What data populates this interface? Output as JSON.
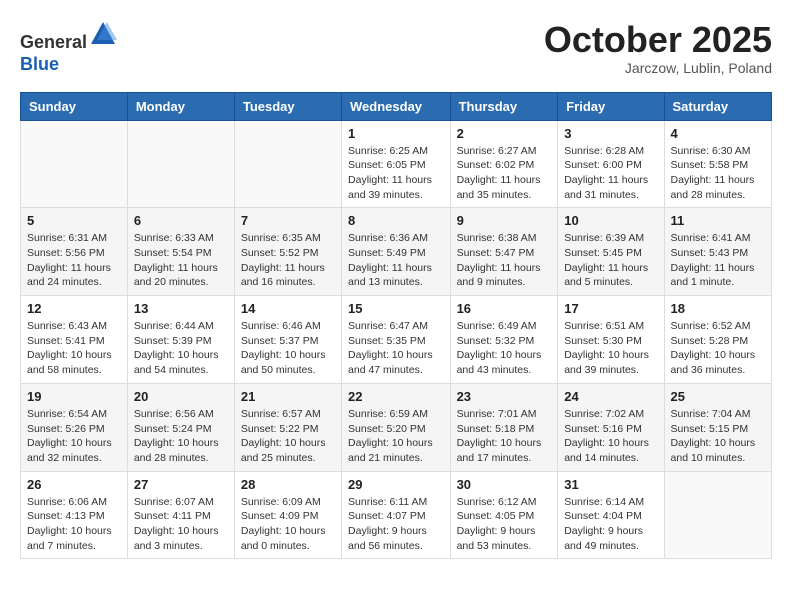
{
  "header": {
    "logo_line1": "General",
    "logo_line2": "Blue",
    "month": "October 2025",
    "location": "Jarczow, Lublin, Poland"
  },
  "weekdays": [
    "Sunday",
    "Monday",
    "Tuesday",
    "Wednesday",
    "Thursday",
    "Friday",
    "Saturday"
  ],
  "weeks": [
    [
      {
        "day": "",
        "info": ""
      },
      {
        "day": "",
        "info": ""
      },
      {
        "day": "",
        "info": ""
      },
      {
        "day": "1",
        "info": "Sunrise: 6:25 AM\nSunset: 6:05 PM\nDaylight: 11 hours\nand 39 minutes."
      },
      {
        "day": "2",
        "info": "Sunrise: 6:27 AM\nSunset: 6:02 PM\nDaylight: 11 hours\nand 35 minutes."
      },
      {
        "day": "3",
        "info": "Sunrise: 6:28 AM\nSunset: 6:00 PM\nDaylight: 11 hours\nand 31 minutes."
      },
      {
        "day": "4",
        "info": "Sunrise: 6:30 AM\nSunset: 5:58 PM\nDaylight: 11 hours\nand 28 minutes."
      }
    ],
    [
      {
        "day": "5",
        "info": "Sunrise: 6:31 AM\nSunset: 5:56 PM\nDaylight: 11 hours\nand 24 minutes."
      },
      {
        "day": "6",
        "info": "Sunrise: 6:33 AM\nSunset: 5:54 PM\nDaylight: 11 hours\nand 20 minutes."
      },
      {
        "day": "7",
        "info": "Sunrise: 6:35 AM\nSunset: 5:52 PM\nDaylight: 11 hours\nand 16 minutes."
      },
      {
        "day": "8",
        "info": "Sunrise: 6:36 AM\nSunset: 5:49 PM\nDaylight: 11 hours\nand 13 minutes."
      },
      {
        "day": "9",
        "info": "Sunrise: 6:38 AM\nSunset: 5:47 PM\nDaylight: 11 hours\nand 9 minutes."
      },
      {
        "day": "10",
        "info": "Sunrise: 6:39 AM\nSunset: 5:45 PM\nDaylight: 11 hours\nand 5 minutes."
      },
      {
        "day": "11",
        "info": "Sunrise: 6:41 AM\nSunset: 5:43 PM\nDaylight: 11 hours\nand 1 minute."
      }
    ],
    [
      {
        "day": "12",
        "info": "Sunrise: 6:43 AM\nSunset: 5:41 PM\nDaylight: 10 hours\nand 58 minutes."
      },
      {
        "day": "13",
        "info": "Sunrise: 6:44 AM\nSunset: 5:39 PM\nDaylight: 10 hours\nand 54 minutes."
      },
      {
        "day": "14",
        "info": "Sunrise: 6:46 AM\nSunset: 5:37 PM\nDaylight: 10 hours\nand 50 minutes."
      },
      {
        "day": "15",
        "info": "Sunrise: 6:47 AM\nSunset: 5:35 PM\nDaylight: 10 hours\nand 47 minutes."
      },
      {
        "day": "16",
        "info": "Sunrise: 6:49 AM\nSunset: 5:32 PM\nDaylight: 10 hours\nand 43 minutes."
      },
      {
        "day": "17",
        "info": "Sunrise: 6:51 AM\nSunset: 5:30 PM\nDaylight: 10 hours\nand 39 minutes."
      },
      {
        "day": "18",
        "info": "Sunrise: 6:52 AM\nSunset: 5:28 PM\nDaylight: 10 hours\nand 36 minutes."
      }
    ],
    [
      {
        "day": "19",
        "info": "Sunrise: 6:54 AM\nSunset: 5:26 PM\nDaylight: 10 hours\nand 32 minutes."
      },
      {
        "day": "20",
        "info": "Sunrise: 6:56 AM\nSunset: 5:24 PM\nDaylight: 10 hours\nand 28 minutes."
      },
      {
        "day": "21",
        "info": "Sunrise: 6:57 AM\nSunset: 5:22 PM\nDaylight: 10 hours\nand 25 minutes."
      },
      {
        "day": "22",
        "info": "Sunrise: 6:59 AM\nSunset: 5:20 PM\nDaylight: 10 hours\nand 21 minutes."
      },
      {
        "day": "23",
        "info": "Sunrise: 7:01 AM\nSunset: 5:18 PM\nDaylight: 10 hours\nand 17 minutes."
      },
      {
        "day": "24",
        "info": "Sunrise: 7:02 AM\nSunset: 5:16 PM\nDaylight: 10 hours\nand 14 minutes."
      },
      {
        "day": "25",
        "info": "Sunrise: 7:04 AM\nSunset: 5:15 PM\nDaylight: 10 hours\nand 10 minutes."
      }
    ],
    [
      {
        "day": "26",
        "info": "Sunrise: 6:06 AM\nSunset: 4:13 PM\nDaylight: 10 hours\nand 7 minutes."
      },
      {
        "day": "27",
        "info": "Sunrise: 6:07 AM\nSunset: 4:11 PM\nDaylight: 10 hours\nand 3 minutes."
      },
      {
        "day": "28",
        "info": "Sunrise: 6:09 AM\nSunset: 4:09 PM\nDaylight: 10 hours\nand 0 minutes."
      },
      {
        "day": "29",
        "info": "Sunrise: 6:11 AM\nSunset: 4:07 PM\nDaylight: 9 hours\nand 56 minutes."
      },
      {
        "day": "30",
        "info": "Sunrise: 6:12 AM\nSunset: 4:05 PM\nDaylight: 9 hours\nand 53 minutes."
      },
      {
        "day": "31",
        "info": "Sunrise: 6:14 AM\nSunset: 4:04 PM\nDaylight: 9 hours\nand 49 minutes."
      },
      {
        "day": "",
        "info": ""
      }
    ]
  ]
}
